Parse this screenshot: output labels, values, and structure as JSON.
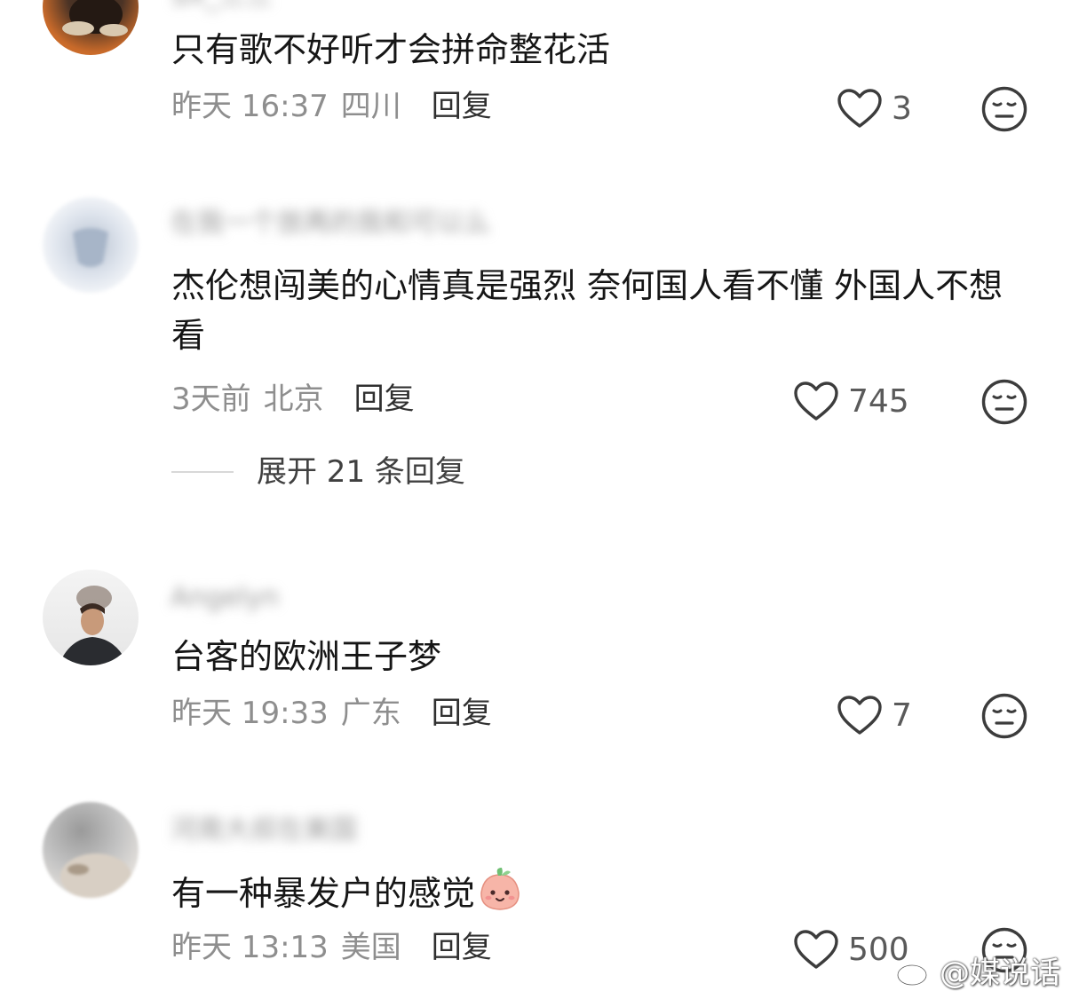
{
  "comments": [
    {
      "username": "SX_三三",
      "text": "只有歌不好听才会拼命整花活",
      "time": "昨天 16:37",
      "location": "四川",
      "reply_label": "回复",
      "likes": "3"
    },
    {
      "username": "在我一个放再的我和可以么",
      "text": "杰伦想闯美的心情真是强烈 奈何国人看不懂 外国人不想看",
      "time": "3天前",
      "location": "北京",
      "reply_label": "回复",
      "likes": "745",
      "expand_label": "展开 21 条回复"
    },
    {
      "username": "Angelyn",
      "text": "台客的欧洲王子梦",
      "time": "昨天 19:33",
      "location": "广东",
      "reply_label": "回复",
      "likes": "7"
    },
    {
      "username": "河南大叔在美国",
      "text": "有一种暴发户的感觉",
      "time": "昨天 13:13",
      "location": "美国",
      "reply_label": "回复",
      "likes": "500"
    }
  ],
  "watermark": {
    "text": "@媒说话",
    "icon": "weibo-logo-icon"
  },
  "icons": {
    "like": "heart-outline-icon",
    "dislike": "meh-face-icon",
    "inline_emoji": "peach-face-emoji"
  },
  "colors": {
    "text": "#161616",
    "meta": "#8e8e8e",
    "reply": "#303030",
    "icon_stroke": "#3c3c3c"
  }
}
